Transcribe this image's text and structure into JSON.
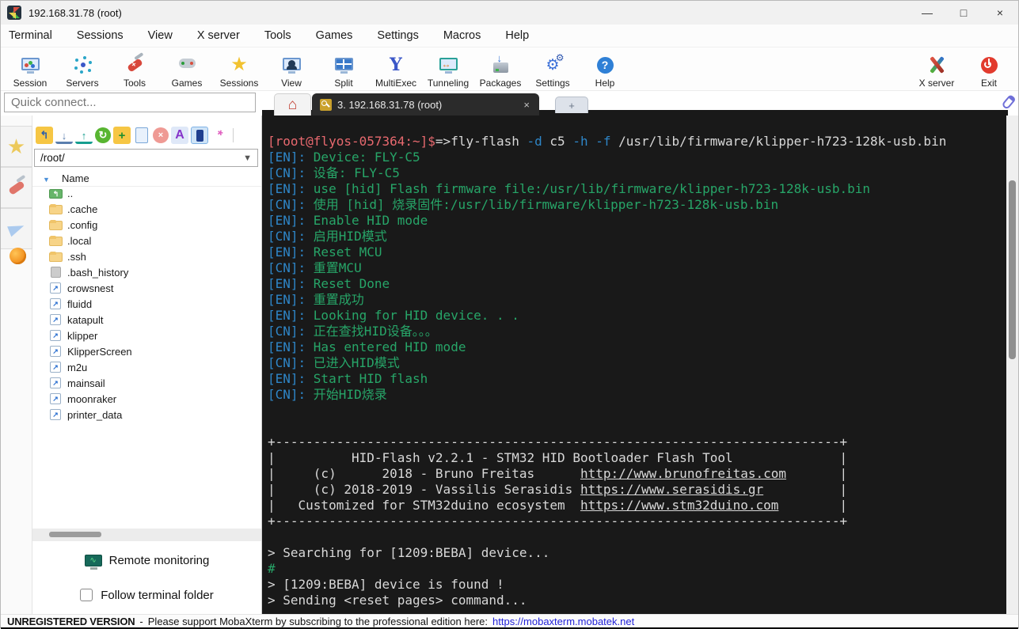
{
  "window": {
    "title": "192.168.31.78 (root)",
    "controls": {
      "minimize": "—",
      "maximize": "□",
      "close": "×"
    }
  },
  "menu": {
    "items": [
      "Terminal",
      "Sessions",
      "View",
      "X server",
      "Tools",
      "Games",
      "Settings",
      "Macros",
      "Help"
    ]
  },
  "toolbar": {
    "items": [
      {
        "label": "Session",
        "icon": "session"
      },
      {
        "label": "Servers",
        "icon": "servers"
      },
      {
        "label": "Tools",
        "icon": "tools"
      },
      {
        "label": "Games",
        "icon": "games"
      },
      {
        "label": "Sessions",
        "icon": "sessions"
      },
      {
        "label": "View",
        "icon": "view"
      },
      {
        "label": "Split",
        "icon": "split"
      },
      {
        "label": "MultiExec",
        "icon": "multiexec"
      },
      {
        "label": "Tunneling",
        "icon": "tunneling"
      },
      {
        "label": "Packages",
        "icon": "packages"
      },
      {
        "label": "Settings",
        "icon": "settings"
      },
      {
        "label": "Help",
        "icon": "help"
      }
    ],
    "right_items": [
      {
        "label": "X server",
        "icon": "xserver"
      },
      {
        "label": "Exit",
        "icon": "exit"
      }
    ]
  },
  "tabs": {
    "quick_connect_placeholder": "Quick connect...",
    "active_tab_label": "3. 192.168.31.78 (root)",
    "close_glyph": "×",
    "plus_glyph": "+"
  },
  "file_panel": {
    "toolbar_icons": [
      "go-parent",
      "download",
      "upload",
      "refresh",
      "new-folder",
      "new-file",
      "delete",
      "font",
      "sync-terminal",
      "wand"
    ],
    "path": "/root/",
    "header": "Name",
    "items": [
      {
        "name": "..",
        "icon": "folder-up"
      },
      {
        "name": ".cache",
        "icon": "folder"
      },
      {
        "name": ".config",
        "icon": "folder"
      },
      {
        "name": ".local",
        "icon": "folder"
      },
      {
        "name": ".ssh",
        "icon": "folder"
      },
      {
        "name": ".bash_history",
        "icon": "file"
      },
      {
        "name": "crowsnest",
        "icon": "symlink"
      },
      {
        "name": "fluidd",
        "icon": "symlink"
      },
      {
        "name": "katapult",
        "icon": "symlink"
      },
      {
        "name": "klipper",
        "icon": "symlink"
      },
      {
        "name": "KlipperScreen",
        "icon": "symlink"
      },
      {
        "name": "m2u",
        "icon": "symlink"
      },
      {
        "name": "mainsail",
        "icon": "symlink"
      },
      {
        "name": "moonraker",
        "icon": "symlink"
      },
      {
        "name": "printer_data",
        "icon": "symlink"
      }
    ],
    "remote_monitoring_label": "Remote monitoring",
    "follow_label": "Follow terminal folder"
  },
  "terminal": {
    "colors": {
      "background": "#191919",
      "prompt": "#e8696f",
      "blue": "#2e86c8",
      "green": "#27a568",
      "white": "#d8d8d8"
    },
    "lines": [
      [
        [
          "p",
          "[root@flyos-057364:~]$"
        ],
        [
          "w",
          "=>fly-flash "
        ],
        [
          "b",
          "-d"
        ],
        [
          "w",
          " c5 "
        ],
        [
          "b",
          "-h"
        ],
        [
          "w",
          " "
        ],
        [
          "b",
          "-f"
        ],
        [
          "w",
          " /usr/lib/firmware/klipper-h723-128k-usb.bin"
        ]
      ],
      [
        [
          "b",
          "[EN]: "
        ],
        [
          "g",
          "Device: FLY-C5"
        ]
      ],
      [
        [
          "b",
          "[CN]: "
        ],
        [
          "g",
          "设备: FLY-C5"
        ]
      ],
      [
        [
          "b",
          "[EN]: "
        ],
        [
          "g",
          "use [hid] Flash firmware file:/usr/lib/firmware/klipper-h723-128k-usb.bin"
        ]
      ],
      [
        [
          "b",
          "[CN]: "
        ],
        [
          "g",
          "使用 [hid] 烧录固件:/usr/lib/firmware/klipper-h723-128k-usb.bin"
        ]
      ],
      [
        [
          "b",
          "[EN]: "
        ],
        [
          "g",
          "Enable HID mode"
        ]
      ],
      [
        [
          "b",
          "[CN]: "
        ],
        [
          "g",
          "启用HID模式"
        ]
      ],
      [
        [
          "b",
          "[EN]: "
        ],
        [
          "g",
          "Reset MCU"
        ]
      ],
      [
        [
          "b",
          "[CN]: "
        ],
        [
          "g",
          "重置MCU"
        ]
      ],
      [
        [
          "b",
          "[EN]: "
        ],
        [
          "g",
          "Reset Done"
        ]
      ],
      [
        [
          "b",
          "[EN]: "
        ],
        [
          "g",
          "重置成功"
        ]
      ],
      [
        [
          "b",
          "[EN]: "
        ],
        [
          "g",
          "Looking for HID device. . ."
        ]
      ],
      [
        [
          "b",
          "[CN]: "
        ],
        [
          "g",
          "正在查找HID设备。。。"
        ]
      ],
      [
        [
          "b",
          "[EN]: "
        ],
        [
          "g",
          "Has entered HID mode"
        ]
      ],
      [
        [
          "b",
          "[CN]: "
        ],
        [
          "g",
          "已进入HID模式"
        ]
      ],
      [
        [
          "b",
          "[EN]: "
        ],
        [
          "g",
          "Start HID flash"
        ]
      ],
      [
        [
          "b",
          "[CN]: "
        ],
        [
          "g",
          "开始HID烧录"
        ]
      ],
      [],
      [],
      [
        [
          "w",
          "+--------------------------------------------------------------------------+"
        ]
      ],
      [
        [
          "w",
          "|          HID-Flash v2.2.1 - STM32 HID Bootloader Flash Tool              |"
        ]
      ],
      [
        [
          "w",
          "|     (c)      2018 - Bruno Freitas      "
        ],
        [
          "u",
          "http://www.brunofreitas.com"
        ],
        [
          "w",
          "       |"
        ]
      ],
      [
        [
          "w",
          "|     (c) 2018-2019 - Vassilis Serasidis "
        ],
        [
          "u",
          "https://www.serasidis.gr"
        ],
        [
          "w",
          "          |"
        ]
      ],
      [
        [
          "w",
          "|   Customized for STM32duino ecosystem  "
        ],
        [
          "u",
          "https://www.stm32duino.com"
        ],
        [
          "w",
          "        |"
        ]
      ],
      [
        [
          "w",
          "+--------------------------------------------------------------------------+"
        ]
      ],
      [],
      [
        [
          "w",
          "> Searching for [1209:BEBA] device..."
        ]
      ],
      [
        [
          "g",
          "#"
        ]
      ],
      [
        [
          "w",
          "> [1209:BEBA] device is found !"
        ]
      ],
      [
        [
          "w",
          "> Sending <reset pages> command..."
        ]
      ]
    ]
  },
  "statusbar": {
    "version": "UNREGISTERED VERSION",
    "separator": "-",
    "message": "Please support MobaXterm by subscribing to the professional edition here:",
    "link": "https://mobaxterm.mobatek.net"
  }
}
